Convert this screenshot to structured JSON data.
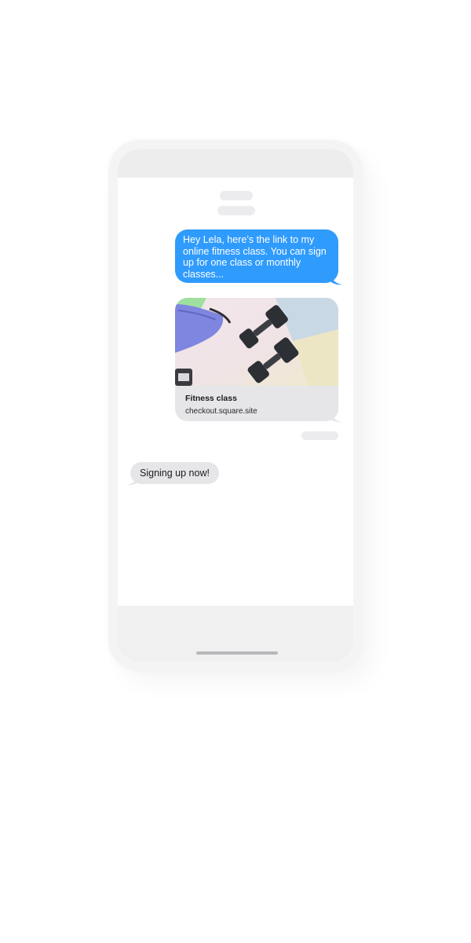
{
  "conversation": {
    "messages": [
      {
        "direction": "outgoing",
        "text": "Hey Lela, here’s the link to my\nonline fitness class. You can sign\nup for one class or monthly\nclasses..."
      },
      {
        "direction": "outgoing",
        "type": "link_preview",
        "image": "dumbbells-photo",
        "title": "Fitness class",
        "url": "checkout.square.site"
      },
      {
        "direction": "incoming",
        "text": "Signing up now!"
      }
    ]
  },
  "colors": {
    "outgoing_bubble": "#2f9bfd",
    "incoming_bubble": "#e6e6e9",
    "screen_background": "#ffffff",
    "phone_shell": "#f4f4f5"
  }
}
